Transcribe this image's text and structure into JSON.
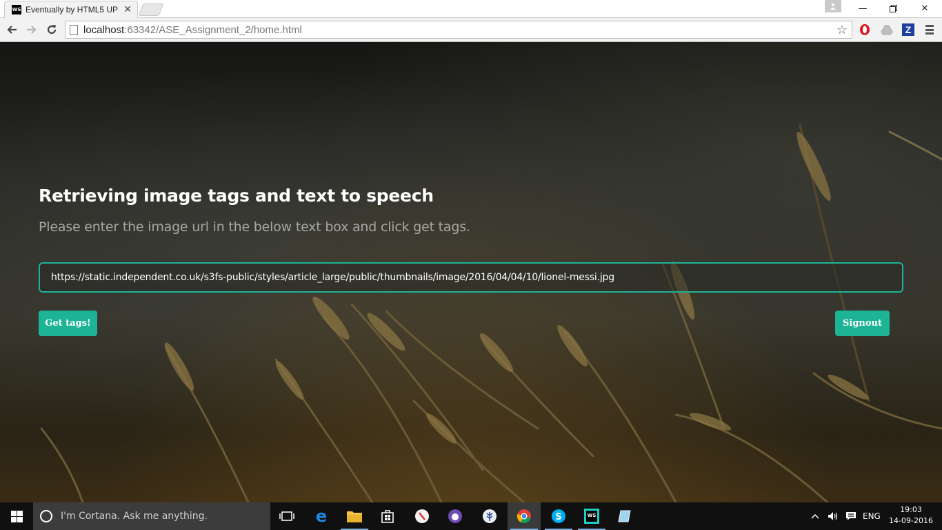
{
  "browser": {
    "tab_title": "Eventually by HTML5 UP",
    "tab_favicon_text": "WS",
    "url_host": "localhost",
    "url_rest": ":63342/ASE_Assignment_2/home.html"
  },
  "page": {
    "heading": "Retrieving image tags and text to speech",
    "subheading": "Please enter the image url in the below text box and click get tags.",
    "url_field_value": "https://static.independent.co.uk/s3fs-public/styles/article_large/public/thumbnails/image/2016/04/04/10/lionel-messi.jpg",
    "get_tags_label": "Get tags!",
    "signout_label": "Signout",
    "accent_color": "#1cb495"
  },
  "taskbar": {
    "cortana_placeholder": "I'm Cortana. Ask me anything.",
    "language": "ENG",
    "time": "19:03",
    "date": "14-09-2016"
  }
}
